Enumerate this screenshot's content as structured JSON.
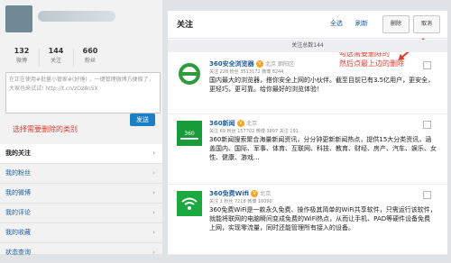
{
  "sidebar": {
    "stats": [
      {
        "num": "132",
        "label": "微博"
      },
      {
        "num": "144",
        "label": "关注"
      },
      {
        "num": "660",
        "label": "粉丝"
      }
    ],
    "compose_text": "在正在使用#批量小管家#(好锤) ，一键管理微博方便极了，大家也来试试! http://t.cn/zOz8n5X",
    "send_label": "发送",
    "nav": [
      {
        "label": "我的关注",
        "active": true
      },
      {
        "label": "我的粉丝",
        "active": false
      },
      {
        "label": "我的微博",
        "active": false
      },
      {
        "label": "我的评论",
        "active": false
      },
      {
        "label": "我的收藏",
        "active": false
      },
      {
        "label": "状态查询",
        "active": false
      }
    ]
  },
  "annotations": {
    "left": "选择需要删除的类别",
    "right_line1": "勾选需要删除的",
    "right_line2": "然后点最上边的删除"
  },
  "main": {
    "title": "关注",
    "select_all": "全选",
    "refresh": "刷新",
    "delete_btn": "删除",
    "unfollow_btn": "取消",
    "count_text": "关注总数144",
    "items": [
      {
        "name": "360安全浏览器",
        "location": "北京 朝阳区",
        "meta": "关注 228  粉丝 3513172  微博 8244",
        "desc": "国内最大的浏览器，搭你安全上网的小伙伴。截至目前已有3.5亿用户，更安全，更轻巧，更可靠。给你最好的浏览体验！",
        "logo_color": "#2e9c3c"
      },
      {
        "name": "360新闻",
        "location": "北京",
        "meta": "关注 69  粉丝 157702  微博 3897  关注 191",
        "desc": "360新闻搜索聚合海量新闻资讯，分分钟更新新闻热点，提供15大分类资讯，涵盖国内、国际、军事、体育、互联网、科技、教育、财经、房产、汽车、娱乐、女性、健康、游戏...",
        "logo_color": "#1a9b3a"
      },
      {
        "name": "360免费Wifi",
        "location": "北京",
        "meta": "关注 1  粉丝 7218  微博 10090",
        "desc": "360免费WiFi是一款永久免费、操作极其简单的WiFi共享软件，只需运行该软件，就能将联网的电脑瞬间变成免费的WiFi热点，从而让手机、PAD等硬件设备免费上网，实现零流量，同时还能管理所有接入的设备。",
        "logo_color": "#1aa83f"
      }
    ]
  },
  "colors": {
    "accent": "#1c7ec3",
    "annotation": "#e23c2e",
    "link": "#1f5fa3"
  }
}
